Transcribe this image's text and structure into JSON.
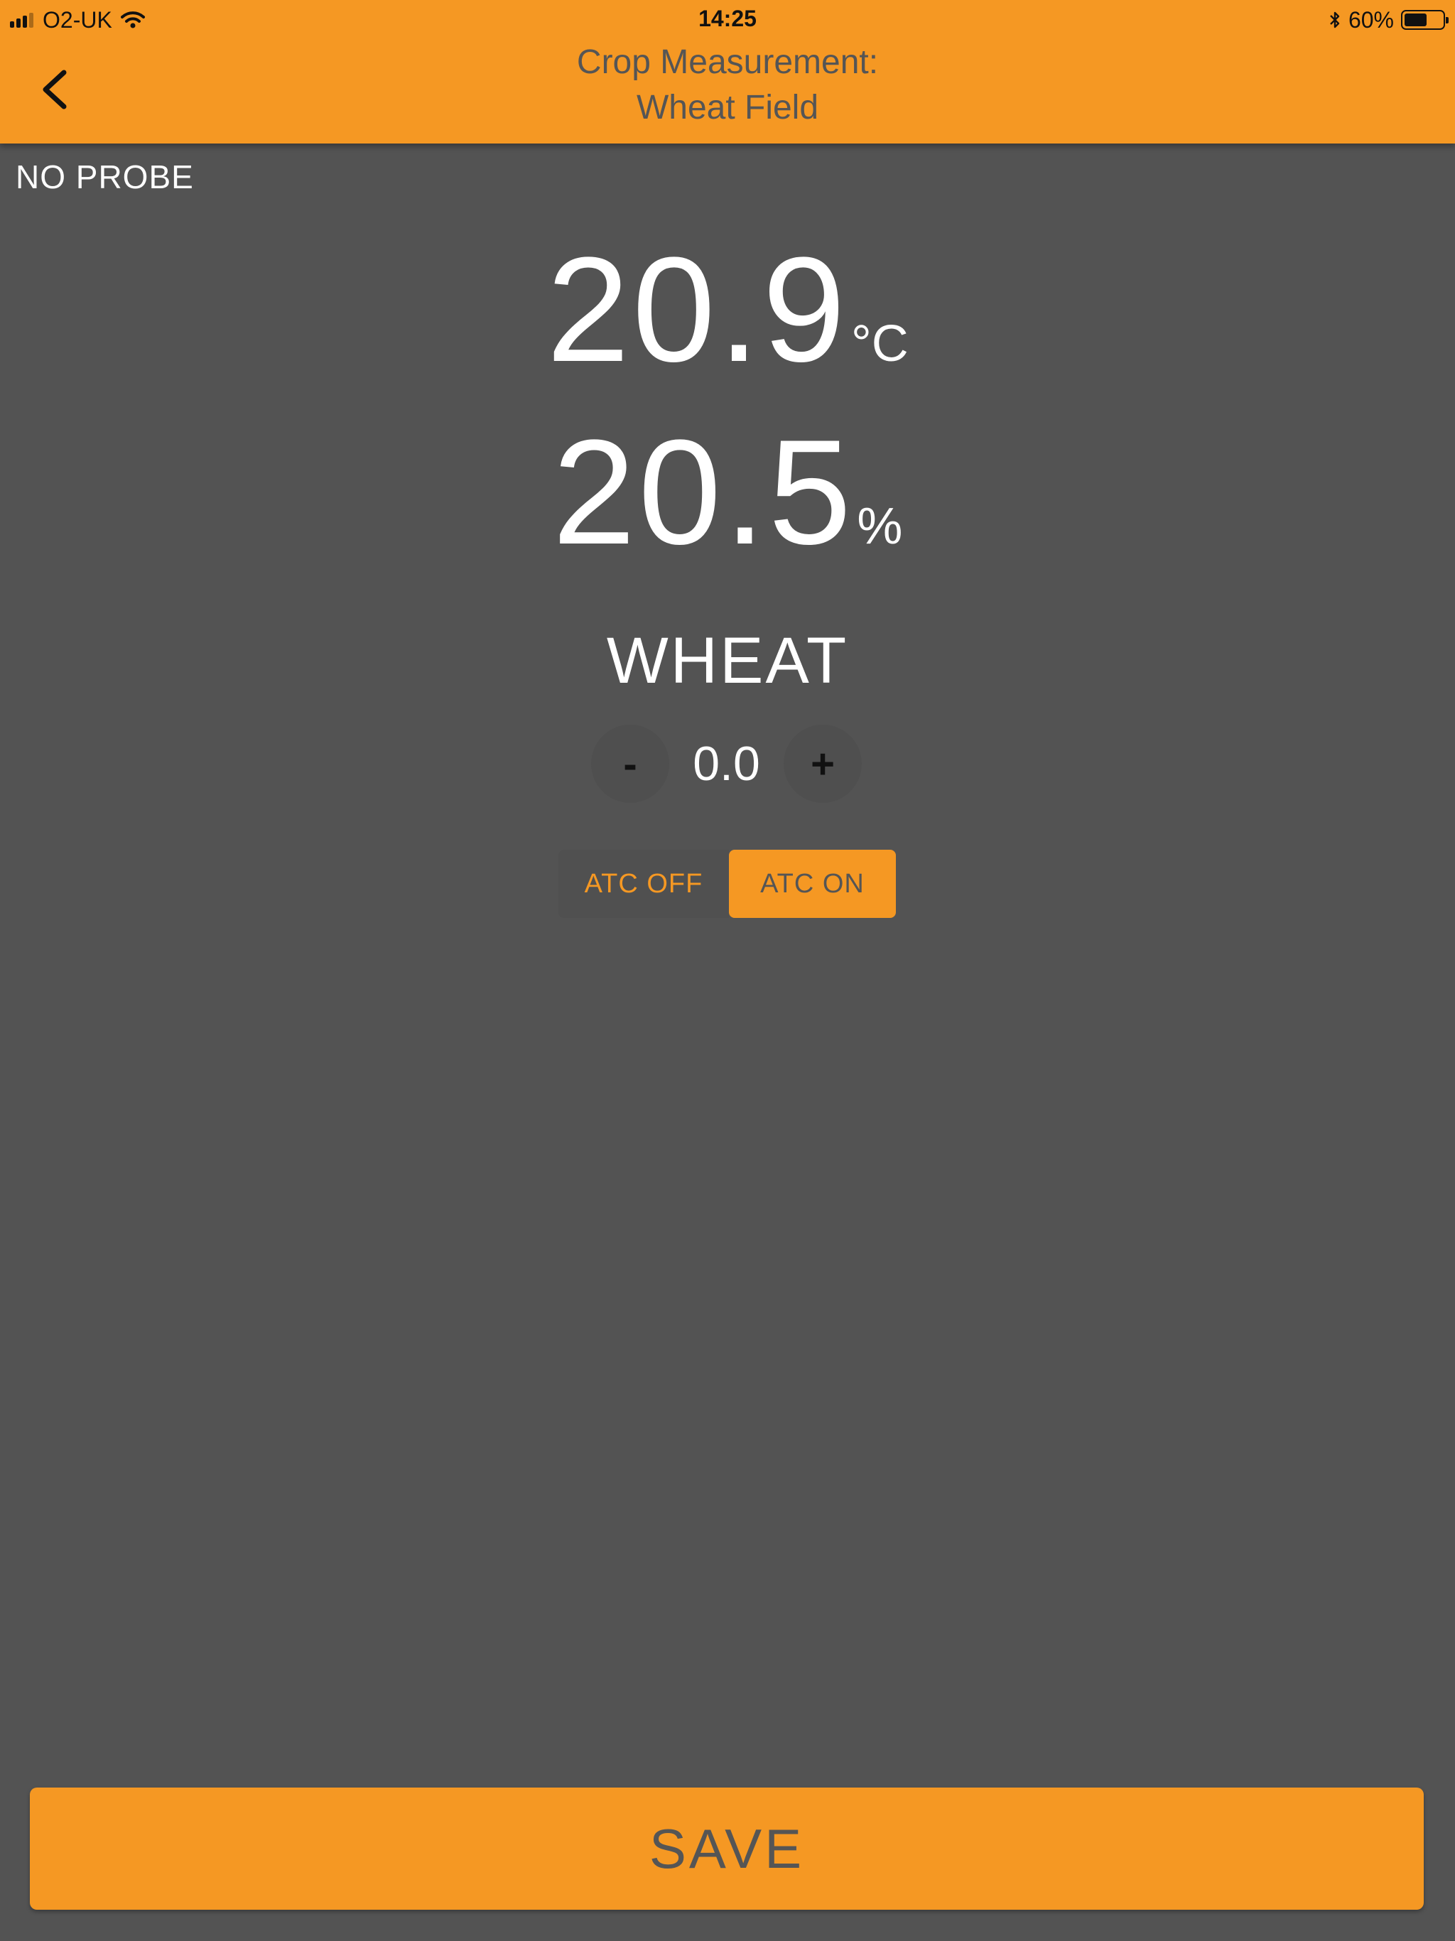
{
  "status_bar": {
    "carrier": "O2-UK",
    "time": "14:25",
    "battery_percent": "60%",
    "battery_level": 0.6,
    "signal_bars_filled": 3,
    "signal_bars_total": 4
  },
  "header": {
    "title_line1": "Crop Measurement:",
    "title_line2": "Wheat Field",
    "back_icon": "chevron-left-icon"
  },
  "probe": {
    "status": "NO PROBE"
  },
  "readings": {
    "temperature": {
      "value": "20.9",
      "unit": "°C"
    },
    "moisture": {
      "value": "20.5",
      "unit": "%"
    }
  },
  "crop": {
    "name": "WHEAT"
  },
  "offset": {
    "minus_label": "-",
    "value": "0.0",
    "plus_label": "+"
  },
  "atc": {
    "off_label": "ATC OFF",
    "on_label": "ATC ON",
    "selected": "on"
  },
  "actions": {
    "save_label": "SAVE"
  },
  "colors": {
    "accent": "#f59823",
    "background": "#535353",
    "text_on_accent": "#555555"
  }
}
